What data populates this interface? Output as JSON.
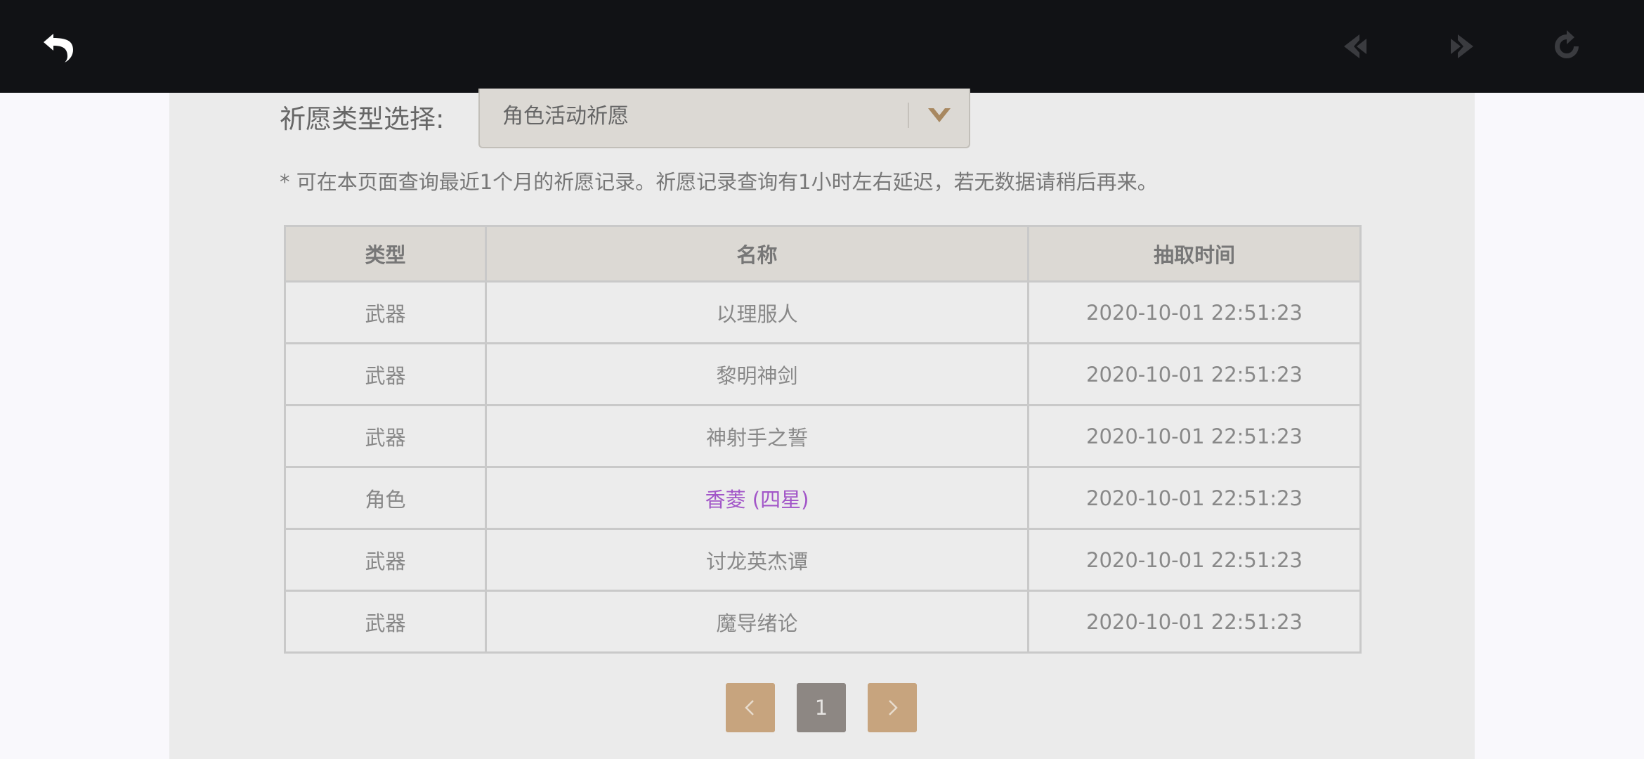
{
  "topbar": {
    "back_icon": "back-arrow-icon",
    "prev_icon": "nav-back-icon",
    "next_icon": "nav-forward-icon",
    "refresh_icon": "refresh-icon"
  },
  "filter": {
    "label": "祈愿类型选择:",
    "selected": "角色活动祈愿",
    "arrow_color": "#a88860"
  },
  "notice": "* 可在本页面查询最近1个月的祈愿记录。祈愿记录查询有1小时左右延迟，若无数据请稍后再来。",
  "table": {
    "headers": [
      "类型",
      "名称",
      "抽取时间"
    ],
    "rows": [
      {
        "type": "武器",
        "name": "以理服人",
        "time": "2020-10-01 22:51:23"
      },
      {
        "type": "武器",
        "name": "黎明神剑",
        "time": "2020-10-01 22:51:23"
      },
      {
        "type": "武器",
        "name": "神射手之誓",
        "time": "2020-10-01 22:51:23"
      },
      {
        "type": "角色",
        "name": "香菱 (四星)",
        "time": "2020-10-01 22:51:23",
        "highlight_color": "#a256c8"
      },
      {
        "type": "武器",
        "name": "讨龙英杰谭",
        "time": "2020-10-01 22:51:23"
      },
      {
        "type": "武器",
        "name": "魔导绪论",
        "time": "2020-10-01 22:51:23"
      }
    ]
  },
  "pagination": {
    "current_page": "1",
    "prev_icon": "chevron-left-icon",
    "next_icon": "chevron-right-icon"
  }
}
